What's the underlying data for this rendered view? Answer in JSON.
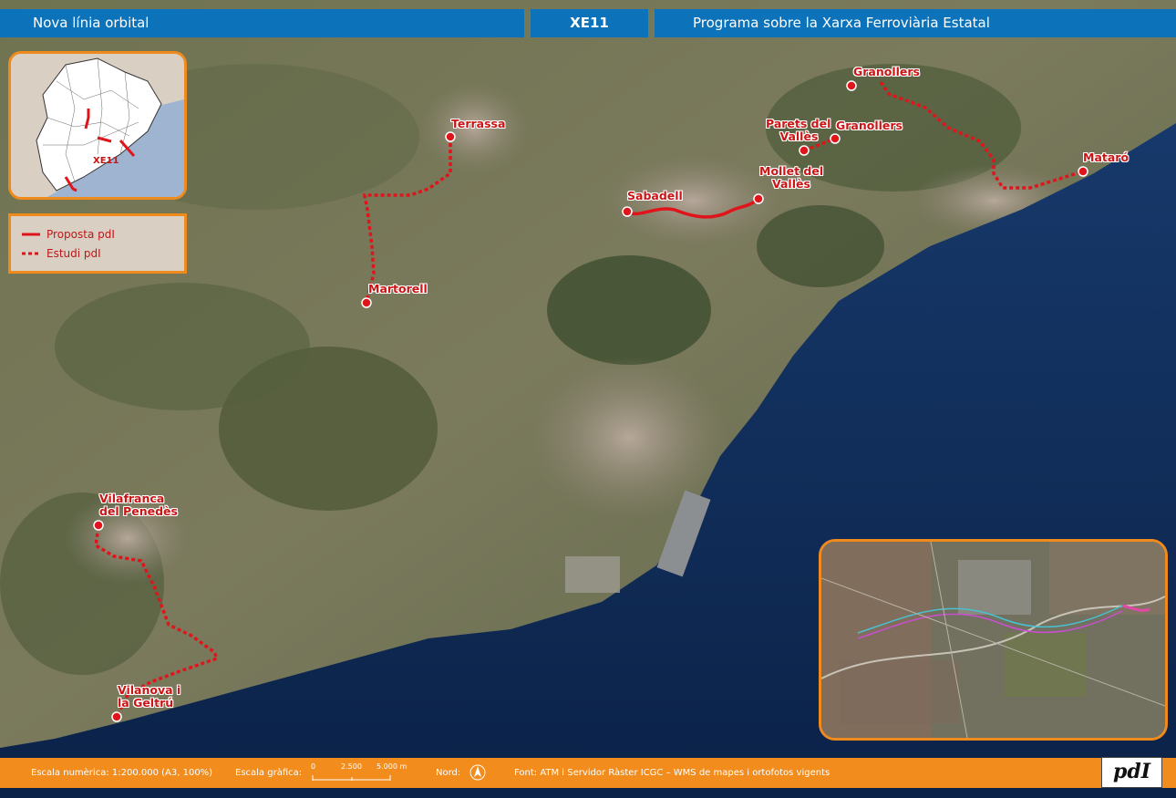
{
  "header": {
    "title": "Nova línia orbital",
    "code": "XE11",
    "program": "Programa sobre la Xarxa Ferroviària Estatal"
  },
  "locator_inset": {
    "label": "XE11"
  },
  "legend": {
    "items": [
      {
        "label": "Proposta pdI",
        "style": "solid"
      },
      {
        "label": "Estudi pdI",
        "style": "dashed"
      }
    ]
  },
  "cities": {
    "terrassa": "Terrassa",
    "martorell": "Martorell",
    "sabadell": "Sabadell",
    "mollet": [
      "Mollet del",
      "Vallès"
    ],
    "parets": [
      "Parets del",
      "Vallès"
    ],
    "granollers_north": "Granollers",
    "granollers": "Granollers",
    "mataro": "Mataró",
    "vilafranca": [
      "Vilafranca",
      "del Penedès"
    ],
    "vilanova": [
      "Vilanova i",
      "la Geltrú"
    ]
  },
  "footer": {
    "scale_numeric": "Escala numèrica: 1:200.000 (A3, 100%)",
    "scale_graphic_label": "Escala gràfica:",
    "scale_ticks": [
      "0",
      "2.500",
      "5.000 m"
    ],
    "north_label": "Nord:",
    "source": "Font: ATM i Servidor Ràster ICGC – WMS de mapes i ortofotos vigents"
  },
  "logo_text": "pdI",
  "colors": {
    "header_blue": "#0c72b9",
    "footer_orange": "#f28c1c",
    "line_red": "#e0151b",
    "sea": "#0f2d5a"
  }
}
